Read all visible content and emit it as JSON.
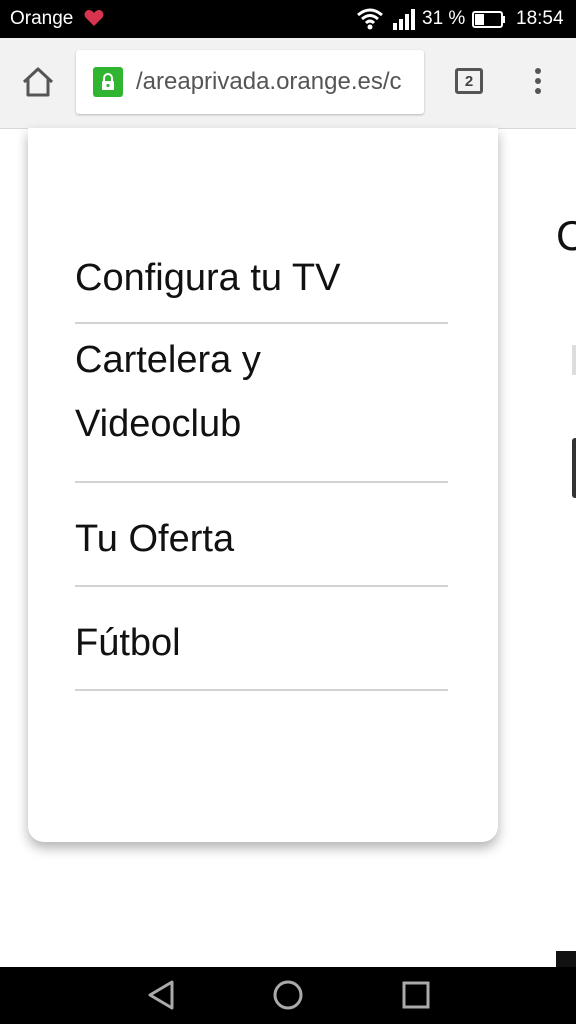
{
  "status_bar": {
    "carrier": "Orange",
    "battery_percent": "31 %",
    "time": "18:54",
    "icons": [
      "heart-icon",
      "wifi-icon",
      "signal-icon",
      "battery-icon"
    ]
  },
  "browser": {
    "url": "/areaprivada.orange.es/c",
    "tab_count": "2",
    "icons": [
      "home-icon",
      "lock-icon",
      "tabs-icon",
      "overflow-menu-icon"
    ]
  },
  "menu": {
    "items": [
      {
        "label": "Configura tu TV"
      },
      {
        "label_line1": "Cartelera y",
        "label_line2": "Videoclub"
      },
      {
        "label": "Tu Oferta"
      },
      {
        "label": "Fútbol"
      }
    ]
  },
  "background": {
    "partial_letter": "C"
  },
  "nav_bar": {
    "icons": [
      "back-icon",
      "home-circle-icon",
      "recents-icon"
    ]
  },
  "colors": {
    "lock_green": "#2fb52f",
    "status_bg": "#000000",
    "divider": "#d2d2d2"
  }
}
